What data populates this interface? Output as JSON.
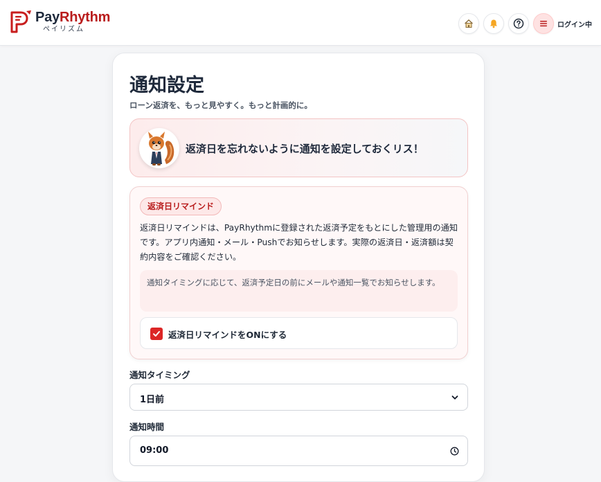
{
  "header": {
    "brand_pay": "Pay",
    "brand_rhythm": "Rhythm",
    "brand_sub": "ペイリズム",
    "icons": [
      "home-icon",
      "bell-icon",
      "help-icon",
      "menu-icon"
    ],
    "login_label": "ログイン中"
  },
  "page": {
    "title": "通知設定",
    "subtitle": "ローン返済を、もっと見やすく。もっと計画的に。"
  },
  "mascot": {
    "message": "返済日を忘れないように通知を設定しておくリス！"
  },
  "reminder": {
    "badge": "返済日リマインド",
    "description": "返済日リマインドは、PayRhythmに登録された返済予定をもとにした管理用の通知です。アプリ内通知・メール・Pushでお知らせします。実際の返済日・返済額は契約内容をご確認ください。",
    "note": "通知タイミングに応じて、返済予定日の前にメールや通知一覧でお知らせします。",
    "checkbox_label": "返済日リマインドをONにする",
    "checkbox_checked": true
  },
  "timing": {
    "label": "通知タイミング",
    "selected": "1日前"
  },
  "time": {
    "label": "通知時間",
    "value": "09:00"
  },
  "colors": {
    "accent": "#dc2626",
    "brand_red": "#b91c1c",
    "text_dark": "#1e293b"
  }
}
